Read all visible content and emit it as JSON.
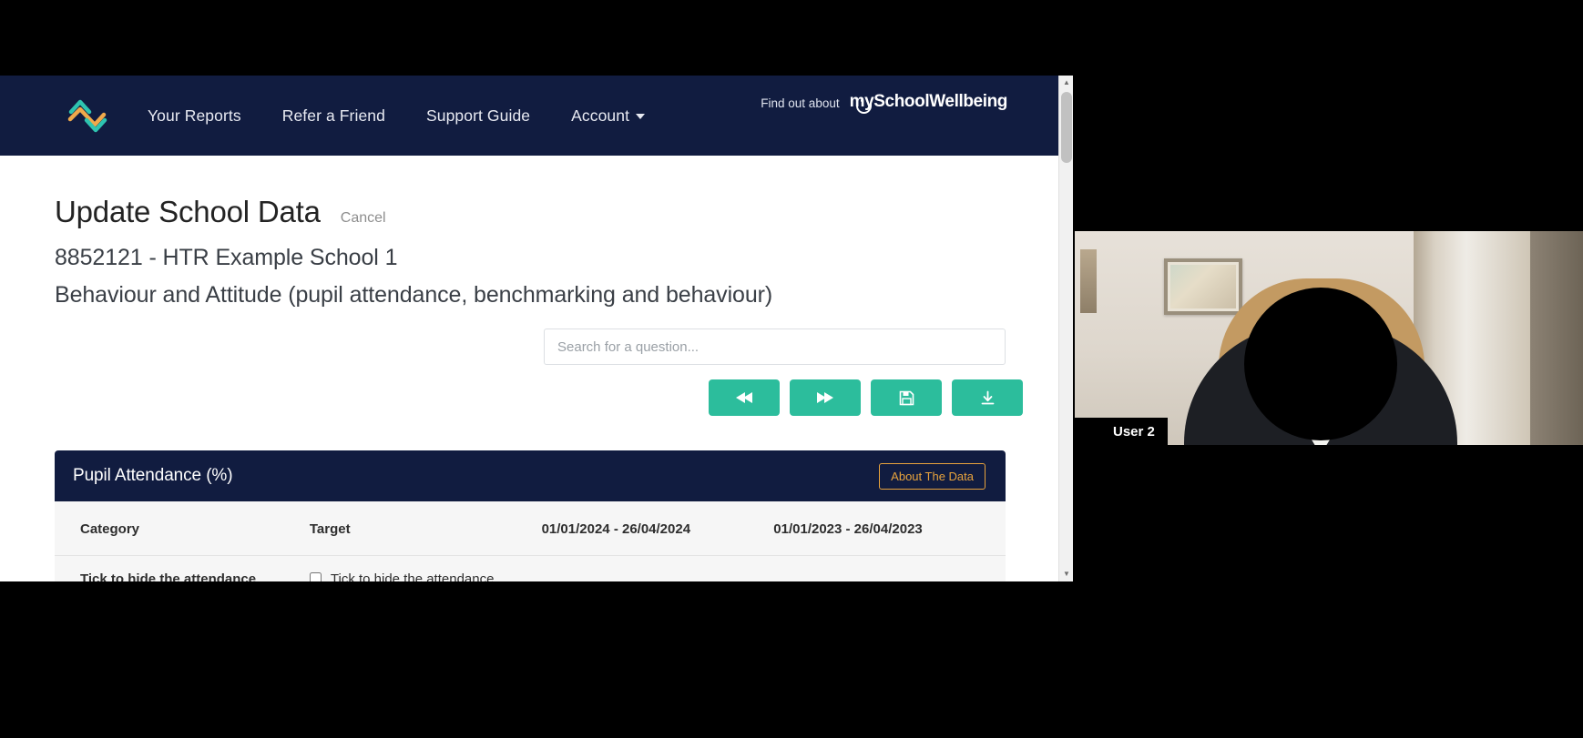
{
  "nav": {
    "brand_logo_icon": "zigzag-chevron-logo",
    "links": [
      {
        "label": "Your Reports",
        "icon": ""
      },
      {
        "label": "Refer a Friend",
        "icon": ""
      },
      {
        "label": "Support Guide",
        "icon": ""
      },
      {
        "label": "Account",
        "icon": "chevron-down-icon"
      }
    ],
    "find_out_about": "Find out about",
    "wordmark": "mySchoolWellbeing",
    "wordmark_my": "my",
    "wordmark_rest": "SchoolWellbeing"
  },
  "page": {
    "title": "Update School Data",
    "cancel_label": "Cancel",
    "school_line": "8852121 - HTR Example School 1",
    "section_line": "Behaviour and Attitude (pupil attendance, benchmarking and behaviour)"
  },
  "search": {
    "value": "",
    "placeholder": "Search for a question..."
  },
  "actions": [
    {
      "name": "rewind-button",
      "icon": "rewind-icon"
    },
    {
      "name": "forward-button",
      "icon": "fast-forward-icon"
    },
    {
      "name": "save-button",
      "icon": "floppy-disk-icon"
    },
    {
      "name": "download-button",
      "icon": "download-icon"
    }
  ],
  "card": {
    "title": "Pupil Attendance (%)",
    "about_label": "About The Data",
    "columns": [
      "Category",
      "Target",
      "01/01/2024 - 26/04/2024",
      "01/01/2023 - 26/04/2023"
    ],
    "rows": [
      {
        "category": "Tick to hide the attendance benchmarking data",
        "target_checkbox_label": "Tick to hide the attendance benchmarking data",
        "target_checked": false,
        "period_2024": "",
        "period_2023": ""
      }
    ]
  },
  "video": {
    "participant_name": "User 2"
  },
  "colors": {
    "navy": "#111c40",
    "teal": "#2cbd9c",
    "orange": "#e8a33d",
    "logo_teal": "#2ec4b0",
    "logo_orange": "#f0a94b"
  }
}
